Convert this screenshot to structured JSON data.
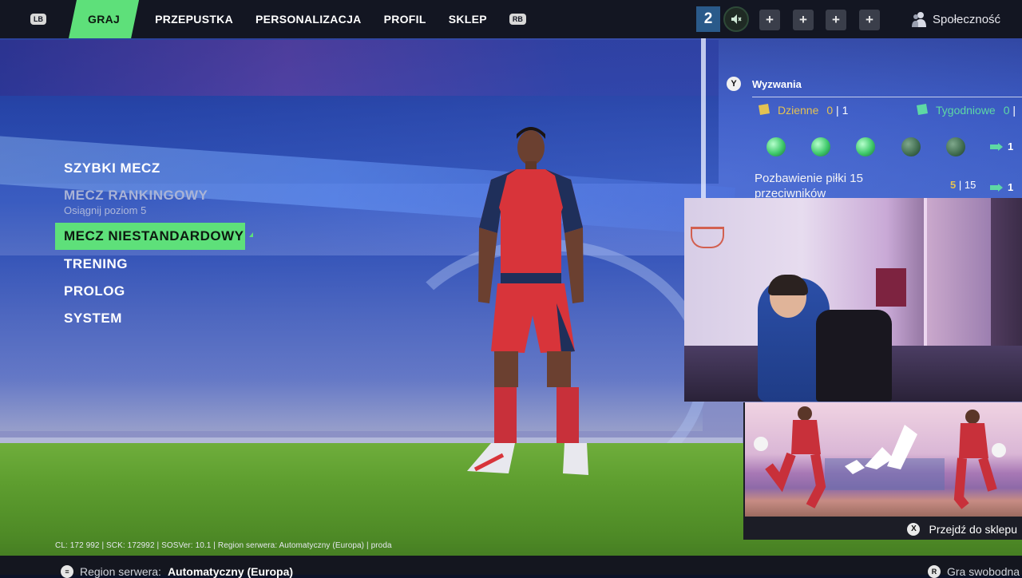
{
  "nav": {
    "left_bumper": "LB",
    "right_bumper": "RB",
    "items": [
      {
        "label": "GRAJ",
        "active": true
      },
      {
        "label": "PRZEPUSTKA",
        "active": false
      },
      {
        "label": "PERSONALIZACJA",
        "active": false
      },
      {
        "label": "PROFIL",
        "active": false
      },
      {
        "label": "SKLEP",
        "active": false
      }
    ],
    "party_count": "2",
    "social_label": "Społeczność"
  },
  "menu": {
    "items": [
      {
        "label": "SZYBKI MECZ"
      },
      {
        "label": "MECZ RANKINGOWY",
        "sublabel": "Osiągnij poziom 5",
        "disabled": true
      },
      {
        "label": "MECZ NIESTANDARDOWY",
        "selected": true
      },
      {
        "label": "TRENING"
      },
      {
        "label": "PROLOG"
      },
      {
        "label": "SYSTEM"
      }
    ]
  },
  "challenges": {
    "button": "Y",
    "title": "Wyzwania",
    "daily": {
      "label": "Dzienne",
      "done": "0",
      "total": "1"
    },
    "weekly": {
      "label": "Tygodniowe",
      "done": "0",
      "total": "|"
    },
    "rewards": [
      "1",
      "1"
    ],
    "task": {
      "description": "Pozbawienie piłki 15 przeciwników",
      "current": "5",
      "target": "15"
    }
  },
  "shop_ad": {
    "button": "X",
    "label": "Przejdź do sklepu"
  },
  "build_info": "CL: 172 992 | SCK: 172992 | SOSVer: 10.1 | Region serwera: Automatyczny (Europa) | proda",
  "bottom_bar": {
    "region_label": "Region serwera:",
    "region_value": "Automatyczny (Europa)",
    "right_label": "Gra swobodna"
  },
  "colors": {
    "accent": "#5ee07a",
    "daily": "#e3c253",
    "weekly": "#5ed8a4",
    "topbar": "#131622"
  }
}
